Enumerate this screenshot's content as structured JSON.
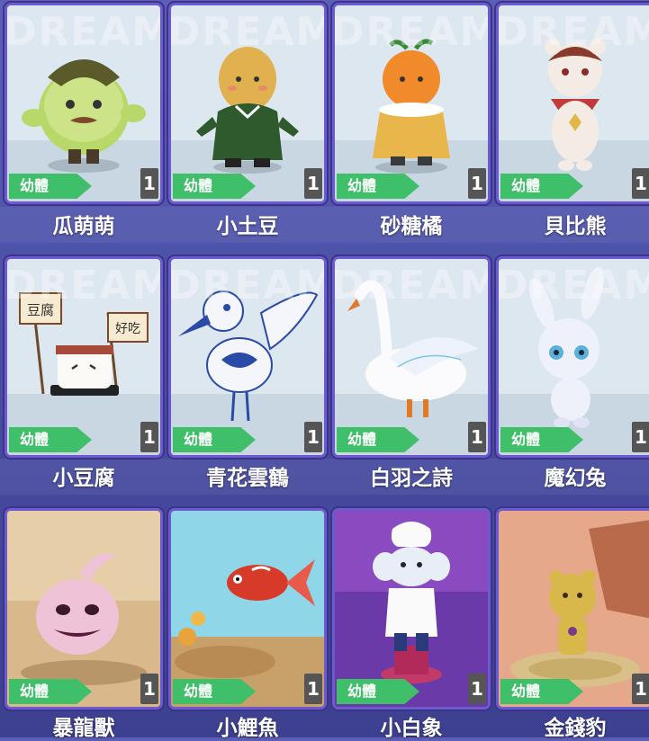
{
  "stage_label": "幼體",
  "watermark": "DREAM",
  "pets": [
    {
      "name": "瓜萌萌",
      "count": "1"
    },
    {
      "name": "小土豆",
      "count": "1"
    },
    {
      "name": "砂糖橘",
      "count": "1"
    },
    {
      "name": "貝比熊",
      "count": "1"
    },
    {
      "name": "小豆腐",
      "count": "1"
    },
    {
      "name": "青花雲鶴",
      "count": "1"
    },
    {
      "name": "白羽之詩",
      "count": "1"
    },
    {
      "name": "魔幻兔",
      "count": "1"
    },
    {
      "name": "暴龍獸",
      "count": "1"
    },
    {
      "name": "小鯉魚",
      "count": "1"
    },
    {
      "name": "小白象",
      "count": "1"
    },
    {
      "name": "金錢豹",
      "count": "1"
    }
  ],
  "flags": [
    "豆腐",
    "好吃"
  ]
}
